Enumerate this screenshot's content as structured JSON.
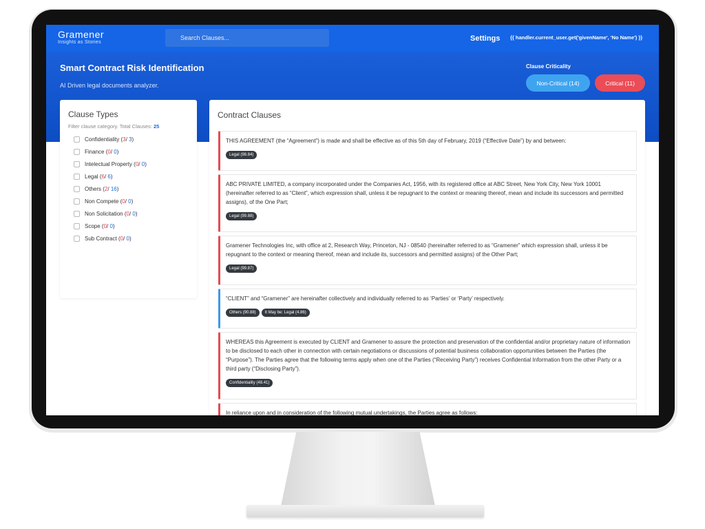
{
  "navbar": {
    "logo_name": "Gramener",
    "logo_tagline": "Insights as Stories",
    "search_placeholder": "Search Clauses...",
    "settings_label": "Settings",
    "user_template": "{{ handler.current_user.get('givenName', 'No Name') }}"
  },
  "hero": {
    "title": "Smart Contract Risk Identification",
    "subtitle": "AI Driven legal documents analyzer.",
    "criticality_label": "Clause Criticality",
    "noncritical_label": "Non-Critical (14)",
    "critical_label": "Critical (11)"
  },
  "sidebar": {
    "title": "Clause Types",
    "filter_text": "Filter clause category. Total Clauses: ",
    "total_clauses": "25",
    "items": [
      {
        "name": "Confidentiality",
        "a": "3",
        "b": "3"
      },
      {
        "name": "Finance",
        "a": "0",
        "b": "0"
      },
      {
        "name": "Intelectual Property",
        "a": "0",
        "b": "0"
      },
      {
        "name": "Legal",
        "a": "6",
        "b": "6"
      },
      {
        "name": "Others",
        "a": "2",
        "b": "16"
      },
      {
        "name": "Non Compete",
        "a": "0",
        "b": "0"
      },
      {
        "name": "Non Solicitation",
        "a": "0",
        "b": "0"
      },
      {
        "name": "Scope",
        "a": "0",
        "b": "0"
      },
      {
        "name": "Sub Contract",
        "a": "0",
        "b": "0"
      }
    ]
  },
  "clauses": {
    "title": "Contract Clauses",
    "items": [
      {
        "text": "THIS AGREEMENT (the “Agreement”) is made and shall be effective as of this 5th day of February, 2019 (“Effective Date”) by and between:",
        "tags": [
          "Legal (98.84)"
        ]
      },
      {
        "text": "ABC PRIVATE LIMITED, a company incorporated under the Companies Act, 1956, with its registered office at ABC Street, New York City, New York 10001 (hereinafter referred to as “Client”, which expression shall, unless it be repugnant to the context or meaning thereof, mean and include its successors and permitted assigns), of the One Part;",
        "tags": [
          "Legal (99.88)"
        ]
      },
      {
        "text": "Gramener Technologies Inc, with office at 2, Research Way, Princeton, NJ - 08540 (hereinafter referred to as “Gramener” which expression shall, unless it be repugnant to the context or meaning thereof, mean and include its, successors and permitted assigns) of the Other Part;",
        "tags": [
          "Legal (99.87)"
        ]
      },
      {
        "text": "“CLIENT” and “Gramener” are hereinafter collectively and individually referred to as ‘Parties’ or ‘Party’ respectively.",
        "tags": [
          "Others (90.88)",
          "It May be: Legal (4.86)"
        ]
      },
      {
        "text": "WHEREAS this Agreement is executed by CLIENT and Gramener to assure the protection and preservation of the confidential and/or proprietary nature of information to be disclosed to each other in connection with certain negotiations or discussions of potential business collaboration opportunities between the Parties (the “Purpose”). The Parties agree that the following terms apply when one of the Parties (“Receiving Party”) receives Confidential Information from the other Party or a third party (“Disclosing Party”).",
        "tags": [
          "Confidentiality (48.41)"
        ]
      },
      {
        "text": "In reliance upon and in consideration of the following mutual undertakings, the Parties agree as follows:",
        "tags": []
      }
    ]
  }
}
